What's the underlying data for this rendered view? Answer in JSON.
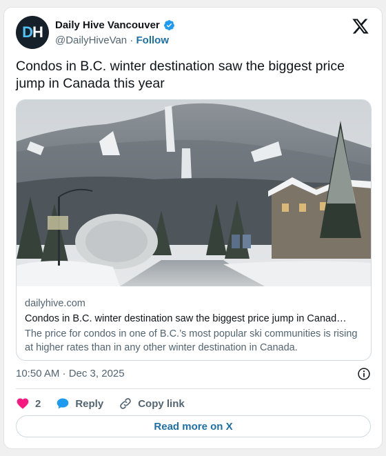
{
  "author": {
    "name": "Daily Hive Vancouver",
    "handle": "@DailyHiveVan",
    "separator": "·",
    "follow_label": "Follow",
    "avatar_text_1": "D",
    "avatar_text_2": "H"
  },
  "tweet": {
    "text": "Condos in B.C. winter destination saw the biggest price jump in Canada this year"
  },
  "link_card": {
    "domain": "dailyhive.com",
    "title": "Condos in B.C. winter destination saw the biggest price jump in Canad…",
    "description": "The price for condos in one of B.C.’s most popular ski communities is rising at higher rates than in any other winter destination in Canada."
  },
  "meta": {
    "timestamp": "10:50 AM · Dec 3, 2025"
  },
  "actions": {
    "like_count": "2",
    "reply_label": "Reply",
    "copy_link_label": "Copy link"
  },
  "footer": {
    "read_more_label": "Read more on X"
  },
  "colors": {
    "like": "#f91880",
    "reply": "#1d9bf0",
    "link": "#1d6fa5",
    "verified": "#1d9bf0"
  },
  "icons": {
    "verified": "verified-badge-icon",
    "x_logo": "x-logo-icon",
    "info": "info-icon",
    "heart": "heart-icon",
    "reply": "reply-bubble-icon",
    "link": "link-icon"
  }
}
